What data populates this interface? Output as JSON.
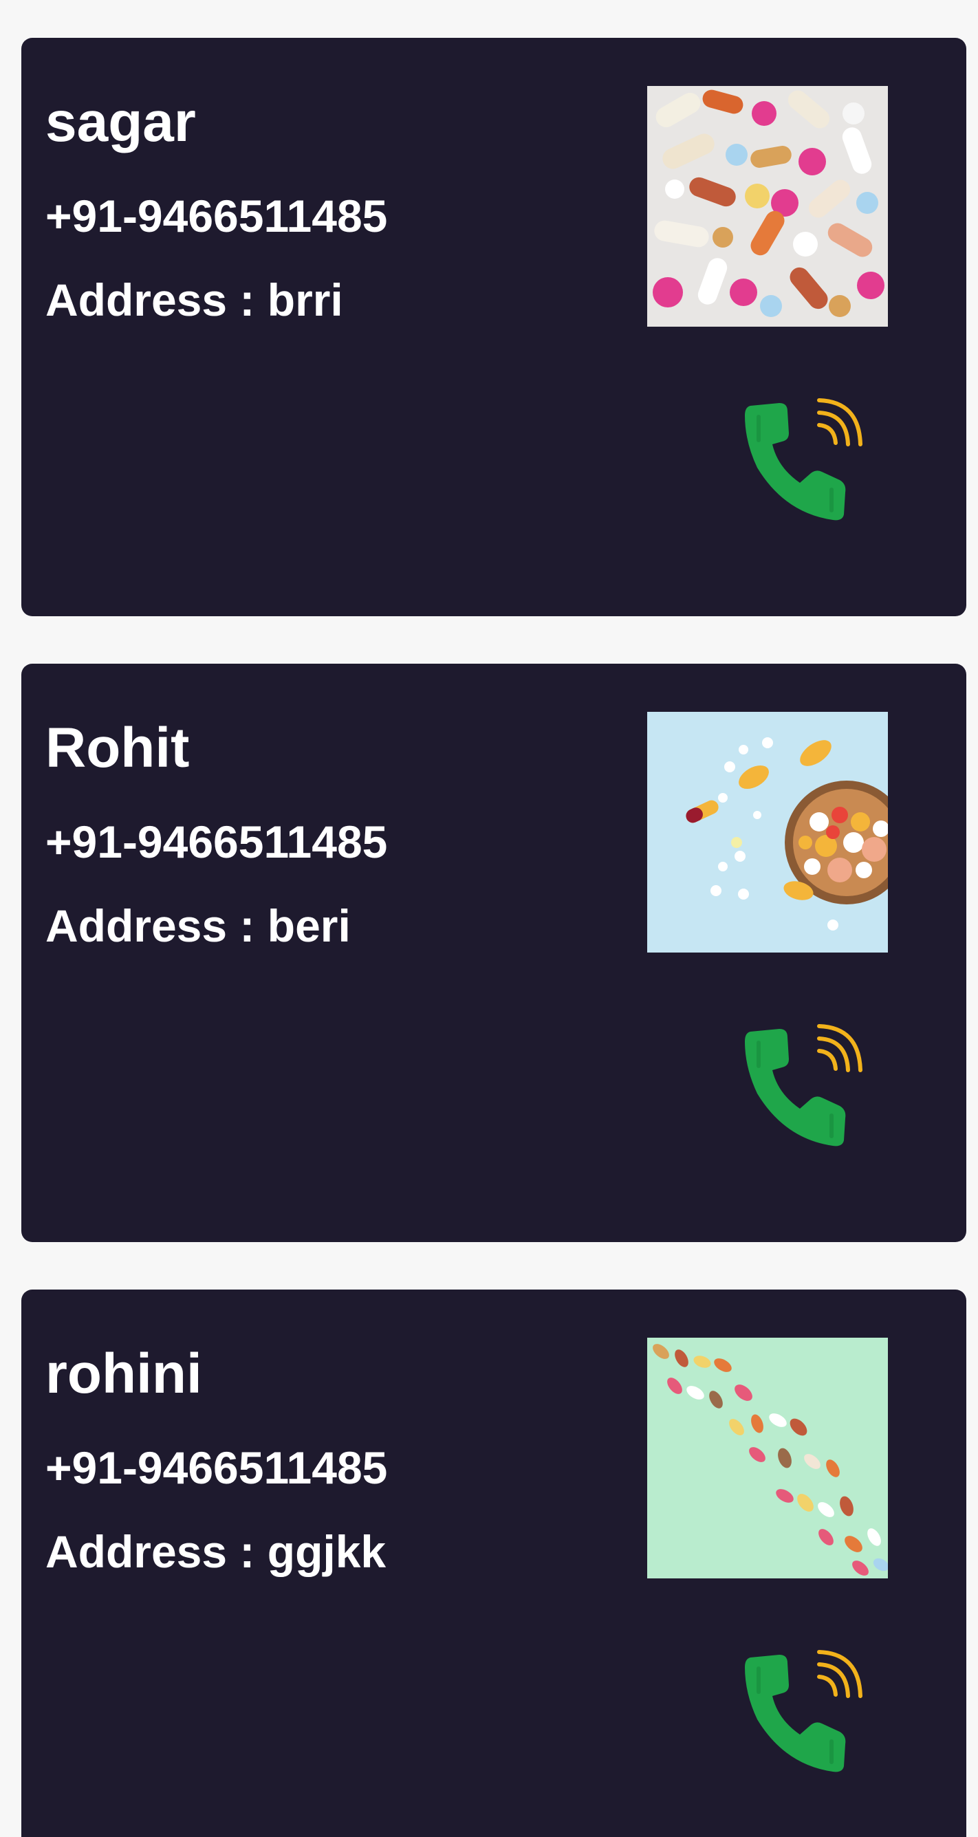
{
  "contacts": [
    {
      "name": "sagar",
      "phone": "+91-9466511485",
      "address": "Address : brri",
      "image_icon": "pills-assorted-image"
    },
    {
      "name": "Rohit",
      "phone": "+91-9466511485",
      "address": "Address : beri",
      "image_icon": "pills-bowl-image"
    },
    {
      "name": "rohini",
      "phone": "+91-9466511485",
      "address": "Address : ggjkk",
      "image_icon": "pills-dna-image"
    }
  ],
  "colors": {
    "card_bg": "#1e1a2e",
    "page_bg": "#f7f7f7",
    "text": "#ffffff",
    "call_green": "#1fa64a",
    "call_waves": "#f2b21b"
  },
  "call_icon": "phone-call-icon"
}
